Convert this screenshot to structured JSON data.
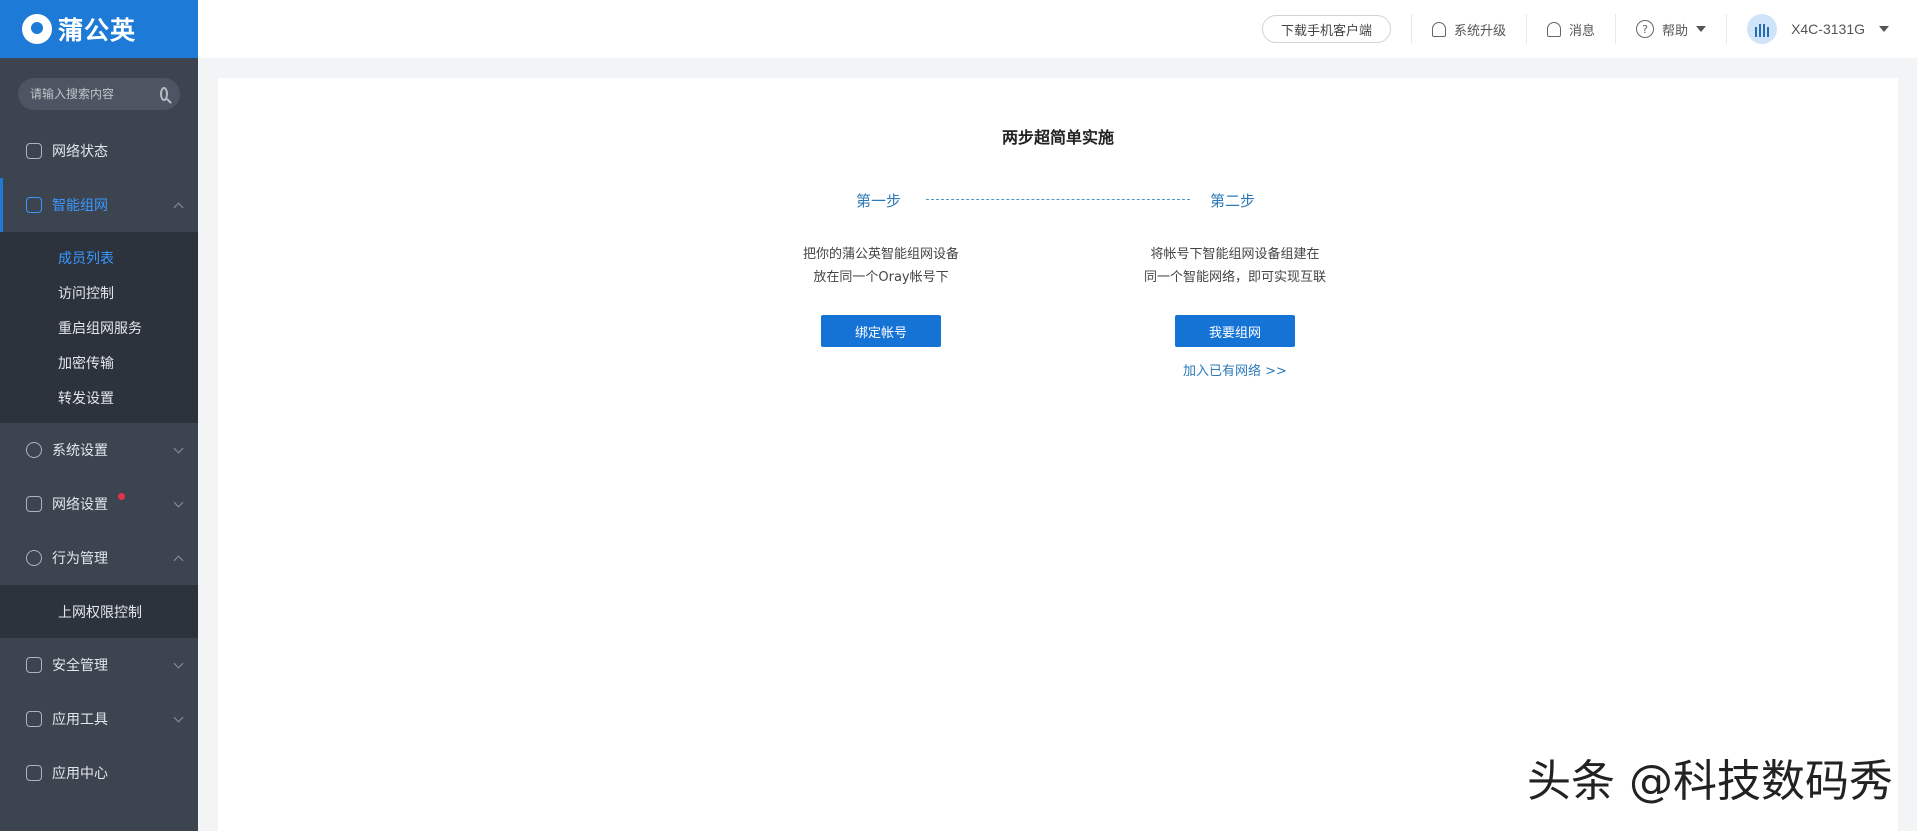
{
  "brand": {
    "name": "蒲公英"
  },
  "search": {
    "placeholder": "请输入搜索内容"
  },
  "sidebar": {
    "items": [
      {
        "label": "网络状态"
      },
      {
        "label": "智能组网"
      },
      {
        "label": "系统设置"
      },
      {
        "label": "网络设置"
      },
      {
        "label": "行为管理"
      },
      {
        "label": "安全管理"
      },
      {
        "label": "应用工具"
      },
      {
        "label": "应用中心"
      }
    ],
    "smart_network_sub": [
      "成员列表",
      "访问控制",
      "重启组网服务",
      "加密传输",
      "转发设置"
    ],
    "behavior_sub": [
      "上网权限控制"
    ]
  },
  "header": {
    "download": "下载手机客户端",
    "upgrade": "系统升级",
    "messages": "消息",
    "help": "帮助",
    "device": "X4C-3131G"
  },
  "main": {
    "title": "两步超简单实施",
    "step1": {
      "label": "第一步",
      "line1": "把你的蒲公英智能组网设备",
      "line2": "放在同一个Oray帐号下",
      "button": "绑定帐号"
    },
    "step2": {
      "label": "第二步",
      "line1": "将帐号下智能组网设备组建在",
      "line2": "同一个智能网络，即可实现互联",
      "button": "我要组网",
      "link": "加入已有网络 >>"
    }
  },
  "watermark": "头条 @科技数码秀",
  "colors": {
    "accent": "#1d7ad6",
    "sidebar": "#3c4450",
    "submenu": "#2c333c"
  }
}
